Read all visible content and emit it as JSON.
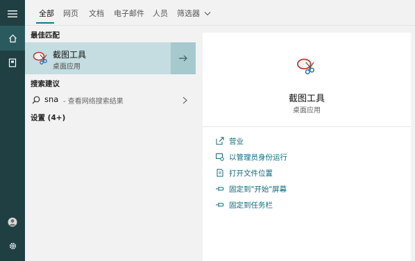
{
  "tabs": [
    {
      "label": "全部",
      "active": true
    },
    {
      "label": "网页",
      "active": false
    },
    {
      "label": "文档",
      "active": false
    },
    {
      "label": "电子邮件",
      "active": false
    },
    {
      "label": "人员",
      "active": false
    },
    {
      "label": "筛选器",
      "active": false
    }
  ],
  "left": {
    "best_match_heading": "最佳匹配",
    "best_match": {
      "title": "截图工具",
      "subtitle": "桌面应用",
      "icon": "snipping-tool-icon"
    },
    "suggestions_heading": "搜索建议",
    "suggestion": {
      "query": "sna",
      "desc": "- 查看网络搜索结果"
    },
    "settings_heading": "设置 (4+)"
  },
  "preview": {
    "title": "截图工具",
    "subtitle": "桌面应用",
    "actions": [
      {
        "label": "营业",
        "icon": "open-icon"
      },
      {
        "label": "以管理员身份运行",
        "icon": "run-as-admin-icon"
      },
      {
        "label": "打开文件位置",
        "icon": "file-location-icon"
      },
      {
        "label": "固定到\"开始\"屏幕",
        "icon": "pin-start-icon"
      },
      {
        "label": "固定到任务栏",
        "icon": "pin-taskbar-icon"
      }
    ]
  },
  "colors": {
    "rail": "#1f3f42",
    "accent": "#0e7a8a",
    "highlight": "#c5dde0"
  }
}
